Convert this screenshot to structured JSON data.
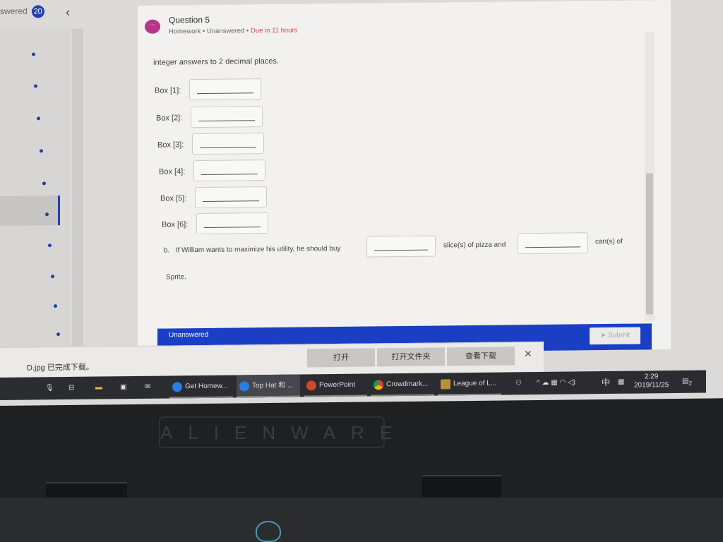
{
  "sidebar": {
    "header_label": "swered",
    "unanswered_count": "20",
    "back_icon": "chevron-left"
  },
  "question": {
    "title": "Question 5",
    "type": "Homework",
    "status": "Unanswered",
    "due": "Due in 11 hours",
    "instruction": "integer answers to 2 decimal places.",
    "boxes": [
      "Box [1]:",
      "Box [2]:",
      "Box [3]:",
      "Box [4]:",
      "Box [5]:",
      "Box [6]:"
    ],
    "part_b": {
      "prefix": "b.",
      "text1": "If William wants to maximize his utility, he should buy",
      "text2": "slice(s) of pizza and",
      "text3": "can(s) of",
      "text4": "Sprite."
    },
    "footer_status": "Unanswered",
    "submit_label": "Submit"
  },
  "download_bar": {
    "filename": "D.jpg 已完成下载。",
    "open": "打开",
    "open_folder": "打开文件夹",
    "view_downloads": "查看下载"
  },
  "taskbar": {
    "apps": [
      "Get Homew...",
      "Top Hat 和 ...",
      "PowerPoint",
      "Crowdmark...",
      "League of L..."
    ],
    "ime": "中",
    "time": "2:29",
    "date": "2019/11/25",
    "notifications": "2"
  },
  "bezel": {
    "brand": "ALIENWARE"
  },
  "colors": {
    "accent": "#1f3fb0",
    "due": "#d04a4a",
    "avatar": "#b8348a"
  }
}
